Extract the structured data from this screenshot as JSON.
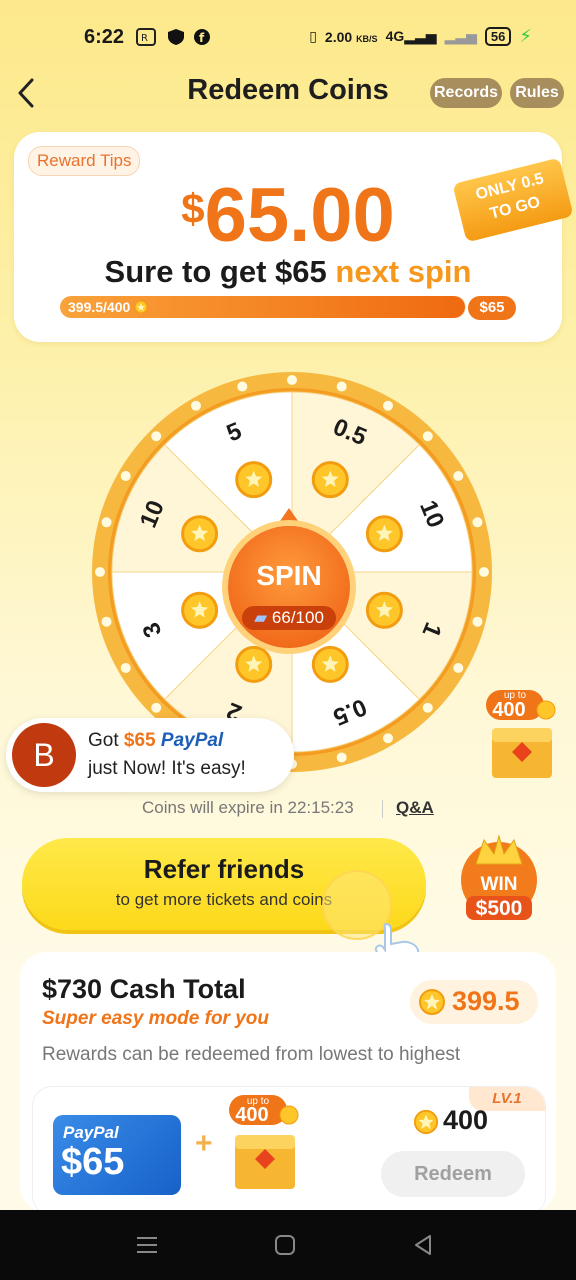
{
  "status_bar": {
    "time": "6:22",
    "speed": "2.00",
    "speed_unit": "KB/S",
    "network": "4G",
    "battery": "56"
  },
  "header": {
    "title": "Redeem Coins",
    "records_label": "Records",
    "rules_label": "Rules"
  },
  "reward": {
    "tips_label": "Reward Tips",
    "currency": "$",
    "amount": "65.00",
    "ribbon_line1": "ONLY 0.5",
    "ribbon_line2": "TO GO",
    "sure_prefix": "Sure to get $65",
    "sure_highlight": "next spin",
    "progress_text": "399.5/400",
    "progress_fraction": 0.99875,
    "progress_end_label": "$65"
  },
  "wheel": {
    "segments": [
      "0.5",
      "10",
      "1",
      "0.5",
      "2",
      "3",
      "10",
      "5"
    ],
    "spin_label": "SPIN",
    "spin_count": "66/100"
  },
  "chest_badge": {
    "upto": "up to",
    "value": "400"
  },
  "toast": {
    "avatar_letter": "B",
    "got": "Got",
    "amount": "$65",
    "brand": "PayPal",
    "line2": "just Now! It's easy!"
  },
  "expire": {
    "text": "Coins will expire in 22:15:23",
    "qa_label": "Q&A"
  },
  "refer": {
    "title": "Refer friends",
    "subtitle": "to get more tickets and coins"
  },
  "win_badge": {
    "win": "WIN",
    "amount": "$500"
  },
  "cash": {
    "title": "$730 Cash Total",
    "subtitle": "Super easy mode for you",
    "balance": "399.5",
    "description": "Rewards can be redeemed from lowest to highest",
    "level": {
      "tag": "LV.1",
      "paypal_brand": "PayPal",
      "paypal_amount": "$65",
      "chest_upto": "up to",
      "chest_value": "400",
      "cost": "400",
      "redeem_label": "Redeem"
    }
  },
  "colors": {
    "accent": "#f07418",
    "brand_yellow": "#fcd91a",
    "paypal_blue": "#1661c9"
  }
}
